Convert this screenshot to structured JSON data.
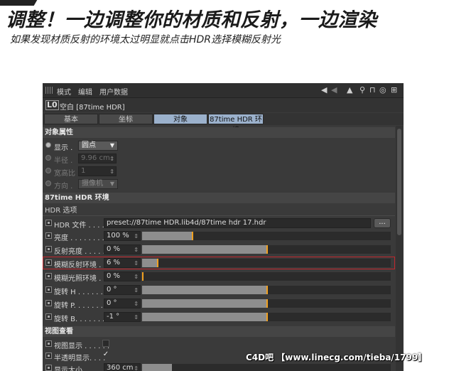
{
  "banner": {
    "headline": "调整！一边调整你的材质和反射，一边渲染",
    "subline": "如果发现材质反射的环境太过明显就点击HDR选择模糊反射光"
  },
  "menubar": {
    "items": [
      "模式",
      "编辑",
      "用户数据"
    ]
  },
  "object": {
    "badge": "L0",
    "name": "空白 [87time HDR]"
  },
  "tabs": [
    {
      "label": "基本",
      "active": false
    },
    {
      "label": "坐标",
      "active": false
    },
    {
      "label": "对象",
      "active": true
    },
    {
      "label": "87time HDR 环境",
      "active": true
    }
  ],
  "object_props": {
    "title": "对象属性",
    "display": {
      "label": "显示 .",
      "value": "圆点"
    },
    "radius": {
      "label": "半径 .",
      "value": "9.96 cm"
    },
    "aspect": {
      "label": "宽高比",
      "value": "1"
    },
    "orientation": {
      "label": "方向 .",
      "value": "摄像机"
    }
  },
  "hdr_section": {
    "title": "87time HDR 环境",
    "options_title": "HDR 选项",
    "hdr_file": {
      "label": "HDR 文件 . . . . .",
      "value": "preset://87time HDR.lib4d/87time hdr 17.hdr",
      "button": "..."
    },
    "rows": [
      {
        "label": "亮度 . . . . . . . . .",
        "value": "100 %",
        "fill": 0.2,
        "knob": 0.2
      },
      {
        "label": "反射亮度 . . . . . .",
        "value": "0 %",
        "fill": 0.5,
        "knob": 0.5
      },
      {
        "label": "模糊反射环境 . .",
        "value": "6 %",
        "fill": 0.06,
        "knob": 0.06,
        "highlighted": true
      },
      {
        "label": "模糊光照环境 . .",
        "value": "0 %",
        "fill": 0.0,
        "knob": 0.0
      },
      {
        "label": "旋转 H . . . . . . .",
        "value": "0 °",
        "fill": 0.5,
        "knob": 0.5
      },
      {
        "label": "旋转 P. . . . . . . .",
        "value": "0 °",
        "fill": 0.5,
        "knob": 0.5
      },
      {
        "label": "旋转 B. . . . . . . .",
        "value": "-1 °",
        "fill": 0.5,
        "knob": 0.5
      }
    ]
  },
  "viewport": {
    "title": "视图查看",
    "view_display": {
      "label": "视图显示 . . . . . .",
      "checked": false
    },
    "semi_transparent": {
      "label": "半透明显示. . . .",
      "checked": true,
      "check_glyph": "✓"
    },
    "display_size": {
      "label": "显示大小. . . . . .",
      "value": "360 cm",
      "fill": 0.12
    }
  },
  "watermark": "C4D吧 【www.linecg.com/tieba/1799】",
  "colors": {
    "accent_knob": "#f0a020",
    "active_tab": "#9bb1cc",
    "highlight": "#c1272d"
  }
}
